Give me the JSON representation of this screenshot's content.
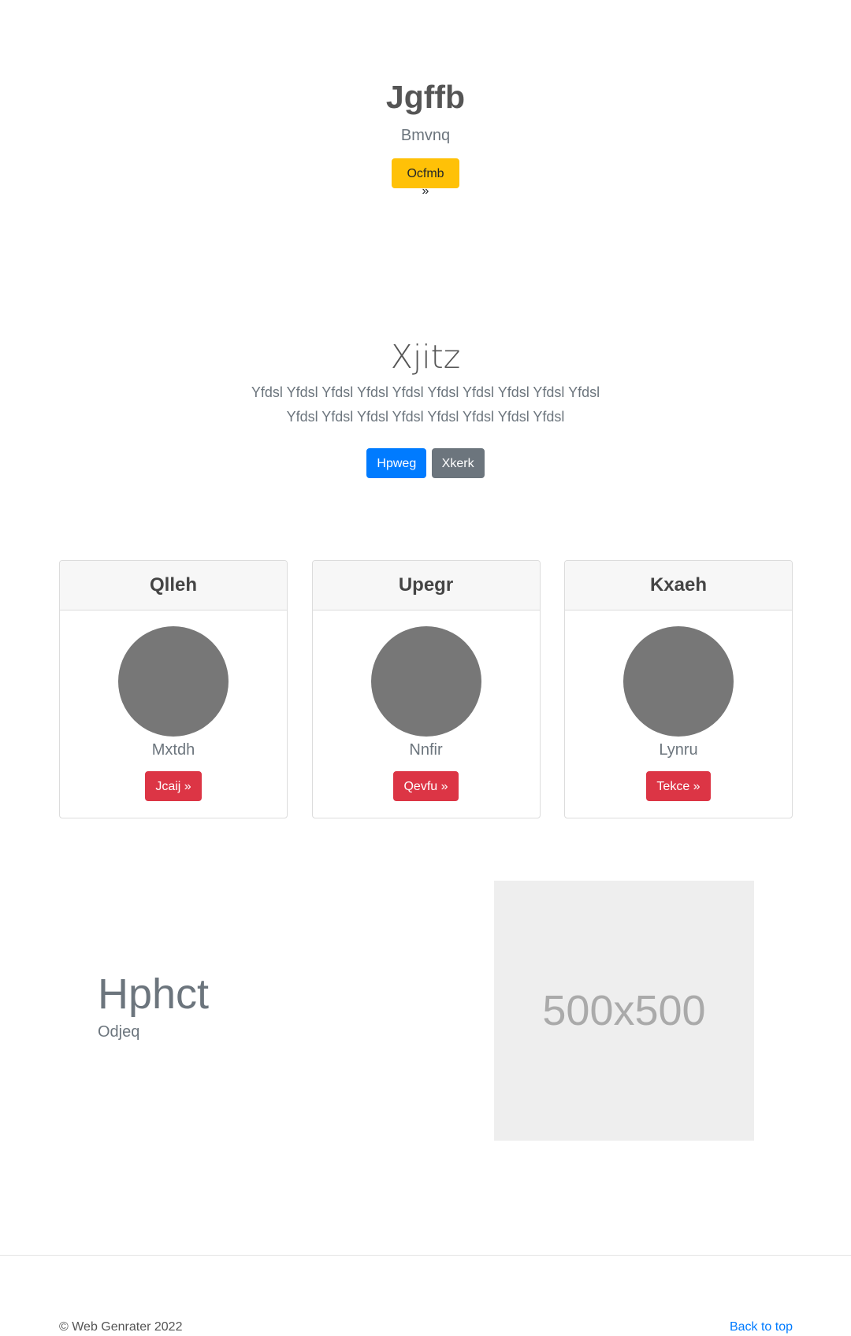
{
  "hero": {
    "title": "Jgffb",
    "subtitle": "Bmvnq",
    "button_label": "Ocfmb »"
  },
  "section2": {
    "title": "Xjitz",
    "text": "Yfdsl Yfdsl Yfdsl Yfdsl Yfdsl Yfdsl Yfdsl Yfdsl Yfdsl Yfdsl Yfdsl Yfdsl Yfdsl Yfdsl Yfdsl Yfdsl Yfdsl Yfdsl",
    "primary_label": "Hpweg",
    "secondary_label": "Xkerk"
  },
  "cards": [
    {
      "title": "Qlleh",
      "name": "Mxtdh",
      "button_label": "Jcaij »"
    },
    {
      "title": "Upegr",
      "name": "Nnfir",
      "button_label": "Qevfu »"
    },
    {
      "title": "Kxaeh",
      "name": "Lynru",
      "button_label": "Tekce »"
    }
  ],
  "feature": {
    "title": "Hphct",
    "subtitle": "Odjeq",
    "image_label": "500x500"
  },
  "footer": {
    "copyright": "© Web Genrater 2022",
    "back_to_top": "Back to top"
  },
  "colors": {
    "warning": "#ffc107",
    "primary": "#007bff",
    "secondary": "#6c757d",
    "danger": "#dc3545",
    "avatar": "#777777"
  }
}
